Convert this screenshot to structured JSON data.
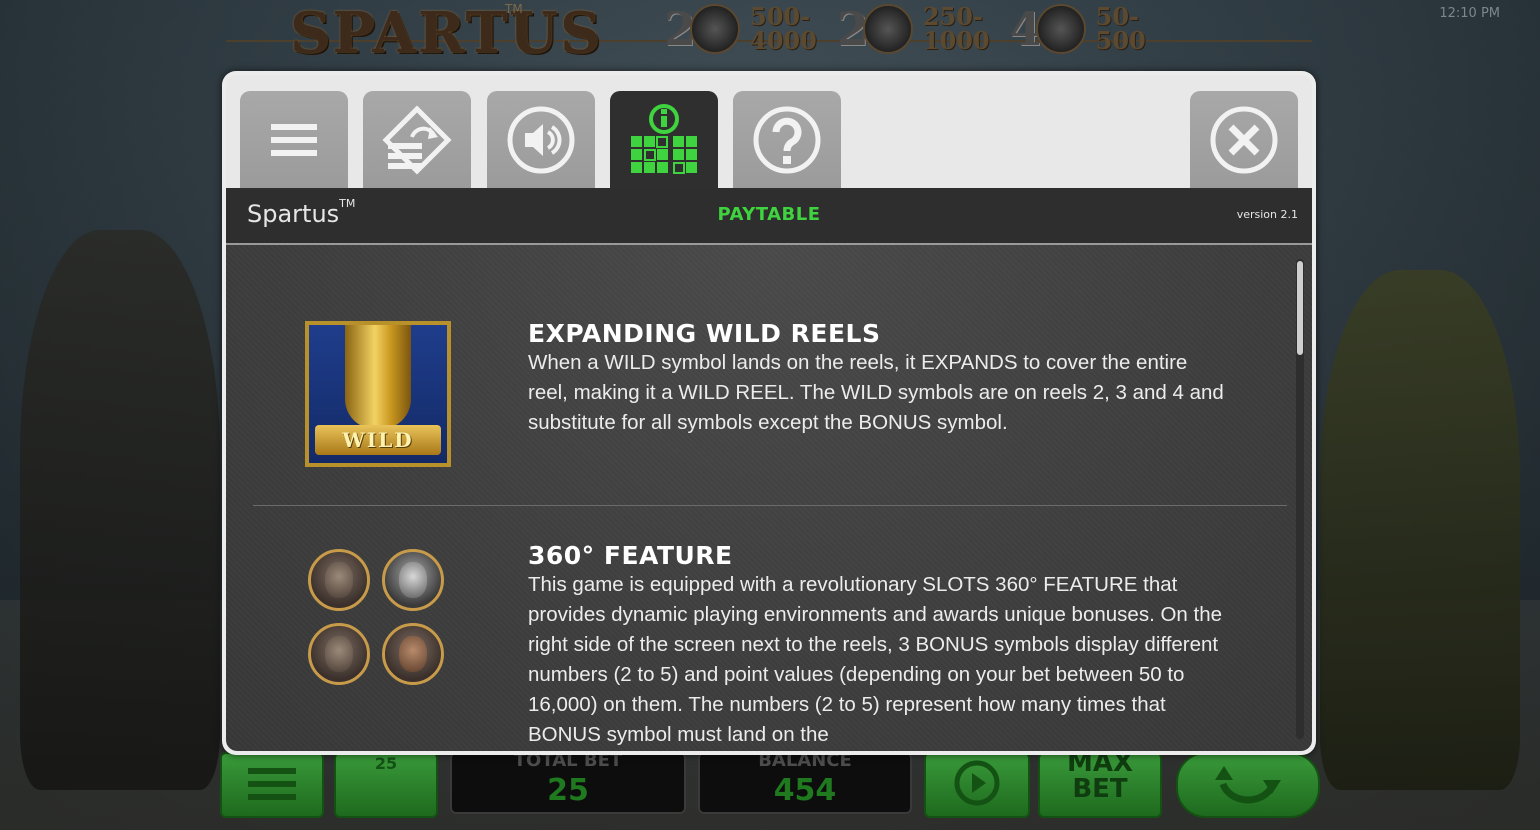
{
  "clock": "12:10 PM",
  "banner": {
    "logo": "SPARTUS",
    "logo_tm": "TM",
    "jackpots": [
      {
        "count": "2",
        "icon": "spartan-helmet-icon",
        "range_top": "500-",
        "range_bottom": "4000"
      },
      {
        "count": "2",
        "icon": "warrior-face-icon",
        "range_top": "250-",
        "range_bottom": "1000"
      },
      {
        "count": "4",
        "icon": "horse-head-icon",
        "range_top": "50-",
        "range_bottom": "500"
      }
    ]
  },
  "tabs": [
    {
      "name": "menu",
      "icon": "hamburger-icon"
    },
    {
      "name": "autoplay",
      "icon": "autoplay-stack-icon"
    },
    {
      "name": "sound",
      "icon": "speaker-icon"
    },
    {
      "name": "paytable",
      "icon": "paytable-info-icon",
      "active": true
    },
    {
      "name": "help",
      "icon": "question-icon"
    }
  ],
  "close_icon": "close-circle-icon",
  "header": {
    "game_title": "Spartus",
    "game_title_tm": "TM",
    "section_title": "PAYTABLE",
    "version": "version 2.1"
  },
  "sections": [
    {
      "heading": "EXPANDING WILD REELS",
      "body": "When a WILD symbol lands on the reels, it EXPANDS to cover the entire reel, making it a WILD REEL. The WILD symbols are on reels 2, 3 and 4 and substitute for all symbols except the BONUS symbol.",
      "symbol_label": "WILD"
    },
    {
      "heading": "360° FEATURE",
      "body": "This game is equipped with a revolutionary SLOTS 360° FEATURE that provides dynamic playing environments and awards unique bonuses. On the right side of the screen next to the reels, 3 BONUS symbols display different numbers (2 to 5) and point values (depending on your bet between 50 to 16,000) on them. The numbers (2 to 5) represent how many times that BONUS symbol must land on the"
    }
  ],
  "bottom_bar": {
    "lines_value": "25",
    "total_bet_label": "TOTAL BET",
    "total_bet_value": "25",
    "balance_label": "BALANCE",
    "balance_value": "454",
    "max_bet_top": "MAX",
    "max_bet_bottom": "BET"
  },
  "colors": {
    "accent_green": "#3fd43f",
    "header_dark": "#2e2e2e",
    "tab_grey": "#a8a8a8",
    "content_bg": "#3e3e3e"
  }
}
